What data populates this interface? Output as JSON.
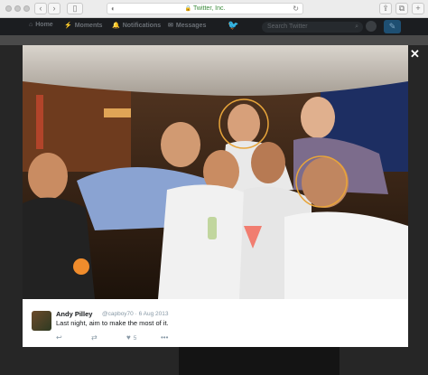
{
  "browser": {
    "url_text": "Twitter, Inc.",
    "lock_icon": "lock-icon",
    "back_label": "‹",
    "forward_label": "›",
    "reload_label": "↻"
  },
  "nav": {
    "home": "Home",
    "moments": "Moments",
    "notifications": "Notifications",
    "messages": "Messages",
    "search_placeholder": "Search Twitter",
    "compose_label": "✎"
  },
  "modal": {
    "close_label": "✕"
  },
  "tweet": {
    "name": "Andy Pilley",
    "handle_date": "@capboy70 · 6 Aug 2013",
    "text": "Last night, aim to make the most of it.",
    "like_count": "5",
    "more_label": "•••"
  },
  "icons": {
    "reply": "reply-icon",
    "retweet": "retweet-icon",
    "like": "heart-icon",
    "more": "more-icon"
  },
  "colors": {
    "highlight_ring": "#e8a53a",
    "twitter_blue": "#1da1f2"
  }
}
